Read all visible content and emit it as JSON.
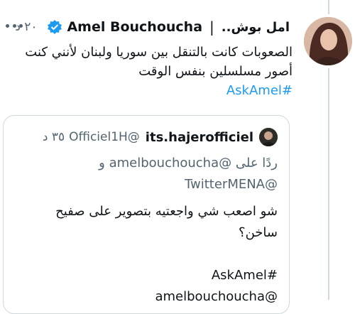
{
  "tweet": {
    "display_name": "Amel Bouchoucha",
    "display_name_ar": "امل بوش..",
    "timestamp": "٢٠ د",
    "separator": "|",
    "text_lines": [
      "الصعوبات كانت بالتنقل بين سوريا ولبنان لأنني كنت",
      "أصور مسلسلين بنفس الوقت"
    ],
    "hashtag": "#AskAmel"
  },
  "quote": {
    "display_name": "its.hajerofficiel",
    "handle": "@Officiel1H",
    "timestamp": "٣٥ د",
    "reply_prefix": "ردًا على",
    "reply_mention_1": "@amelbouchoucha",
    "reply_conj": "و",
    "reply_mention_2": "@TwitterMENA",
    "text_lines": [
      "شو اصعب شي واجعتيه بتصوير على صفيح",
      "ساخن؟",
      "",
      "#AskAmel",
      "@amelbouchoucha"
    ]
  },
  "colors": {
    "accent": "#1d9bf0",
    "muted": "#536471",
    "border": "#cfd9de"
  },
  "icons": {
    "verified": "verified-badge-icon",
    "more": "more-dots-icon"
  }
}
